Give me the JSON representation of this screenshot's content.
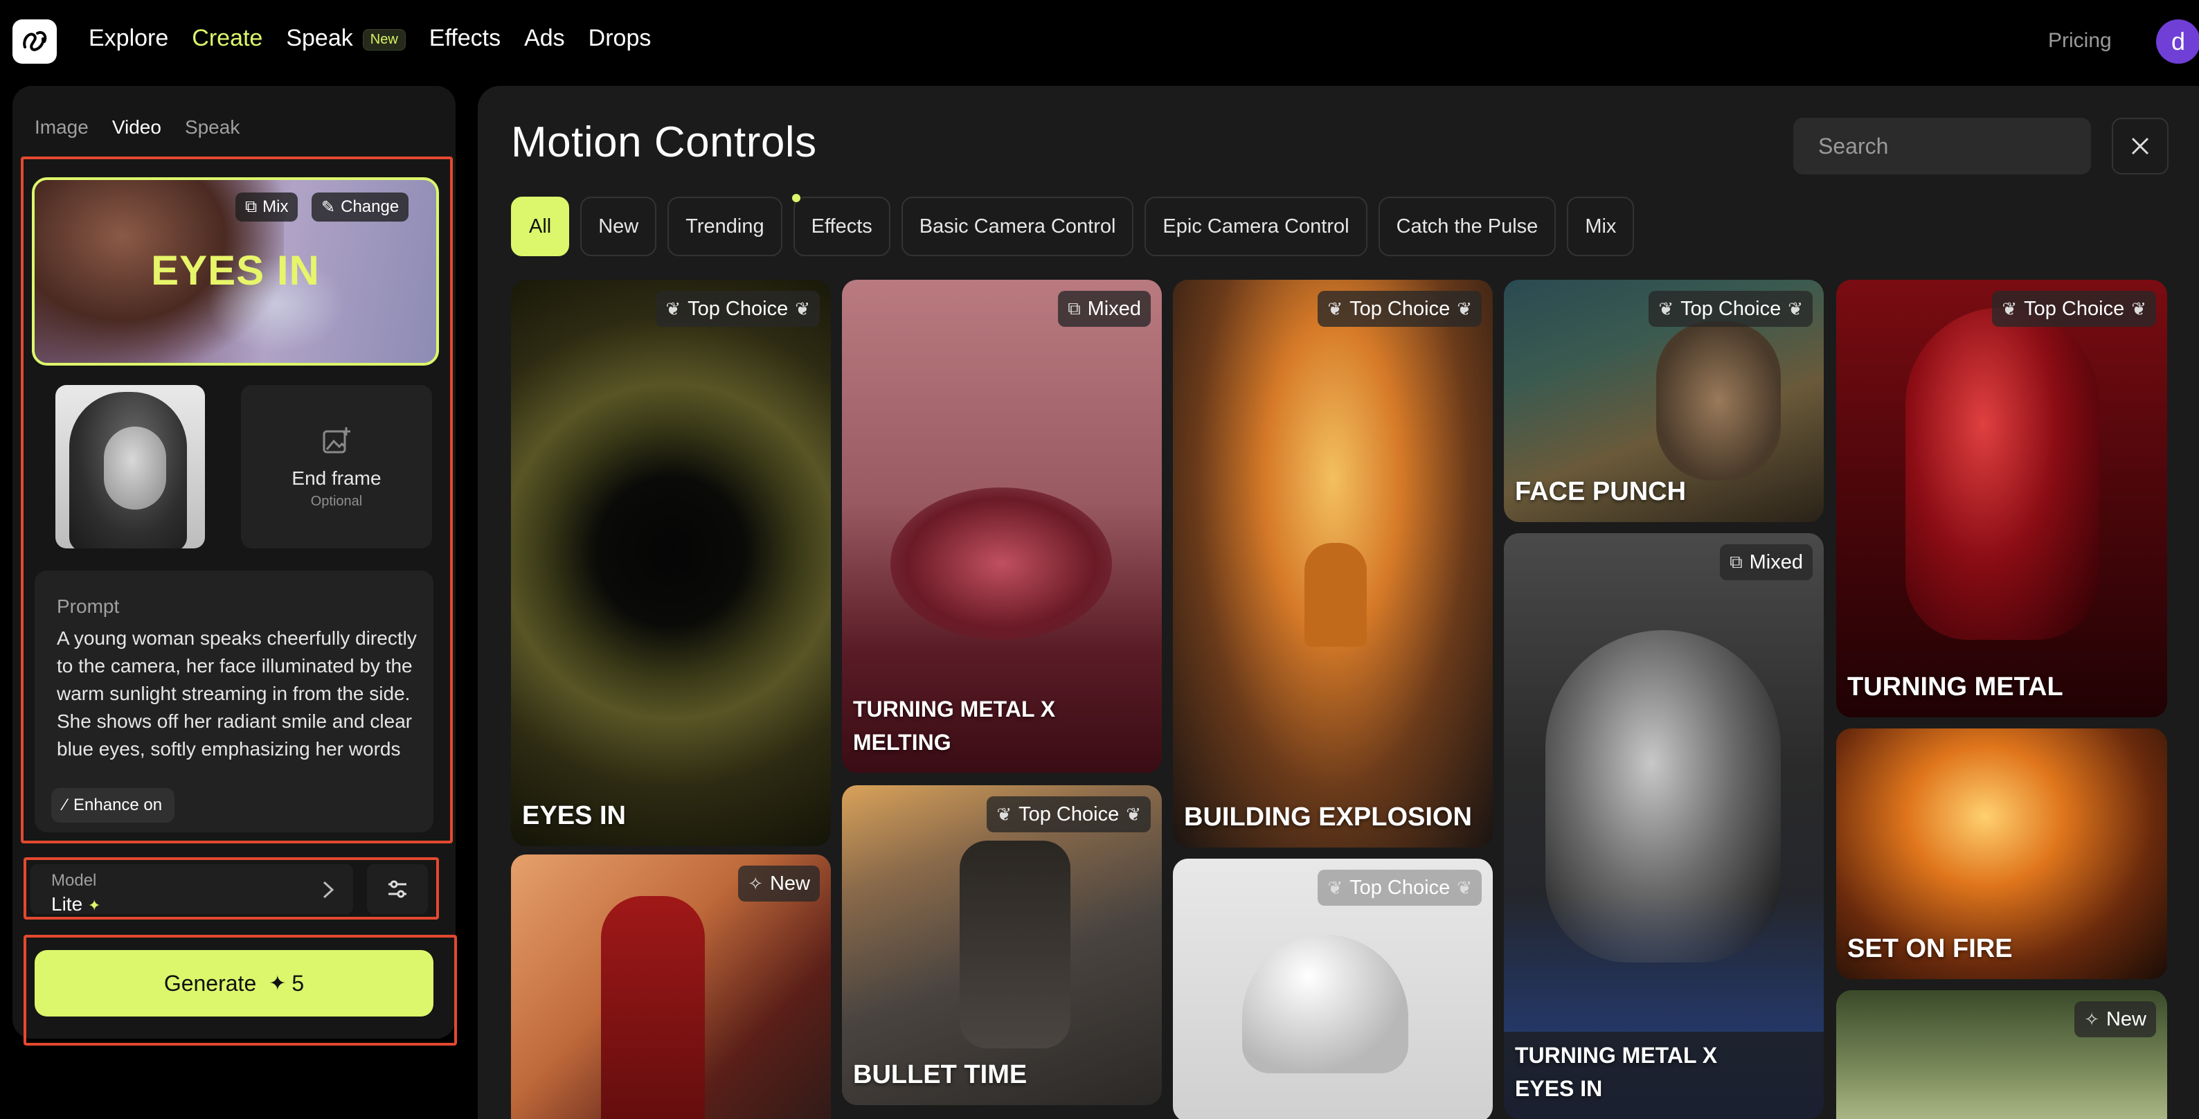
{
  "topbar": {
    "nav": [
      {
        "label": "Explore",
        "active": false
      },
      {
        "label": "Create",
        "active": true
      },
      {
        "label": "Speak",
        "active": false,
        "badge": "New"
      },
      {
        "label": "Effects",
        "active": false
      },
      {
        "label": "Ads",
        "active": false
      },
      {
        "label": "Drops",
        "active": false
      }
    ],
    "pricing": "Pricing",
    "avatar_letter": "d"
  },
  "left": {
    "mode_tabs": [
      "Image",
      "Video",
      "Speak"
    ],
    "active_mode": "Video",
    "effect": {
      "title": "EYES IN",
      "mix_label": "Mix",
      "change_label": "Change"
    },
    "end_frame": {
      "title": "End frame",
      "subtitle": "Optional"
    },
    "prompt": {
      "label": "Prompt",
      "text": "A young woman speaks cheerfully directly to the camera, her face illuminated by the warm sunlight streaming in from the side. She shows off her radiant smile and clear blue eyes, softly emphasizing her words"
    },
    "enhance_label": "Enhance on",
    "model": {
      "label": "Model",
      "value": "Lite"
    },
    "generate": {
      "label": "Generate",
      "cost": "5"
    }
  },
  "main": {
    "title": "Motion Controls",
    "search_placeholder": "Search",
    "filters": [
      "All",
      "New",
      "Trending",
      "Effects",
      "Basic Camera Control",
      "Epic Camera Control",
      "Catch the Pulse",
      "Mix"
    ],
    "active_filter": "All",
    "cards": {
      "eyes_in": {
        "title": "EYES IN",
        "badge": "Top Choice"
      },
      "red_coat": {
        "title": "",
        "badge": "New"
      },
      "turning_metal_melting": {
        "title": "TURNING METAL X MELTING",
        "badge": "Mixed"
      },
      "bullet_time": {
        "title": "BULLET TIME",
        "badge": "Top Choice"
      },
      "building_explosion": {
        "title": "BUILDING EXPLOSION",
        "badge": "Top Choice"
      },
      "helmet": {
        "title": "",
        "badge": "Top Choice"
      },
      "face_punch": {
        "title": "FACE PUNCH",
        "badge": "Top Choice"
      },
      "turning_metal_eyes_in": {
        "title": "TURNING METAL X EYES IN",
        "badge": "Mixed"
      },
      "turning_metal": {
        "title": "TURNING METAL",
        "badge": "Top Choice"
      },
      "set_on_fire": {
        "title": "SET ON FIRE",
        "badge": ""
      },
      "tunnel": {
        "title": "",
        "badge": "New"
      }
    }
  },
  "colors": {
    "accent": "#dcf76b",
    "highlight_box": "#e3492f",
    "avatar": "#6f3fd6"
  }
}
